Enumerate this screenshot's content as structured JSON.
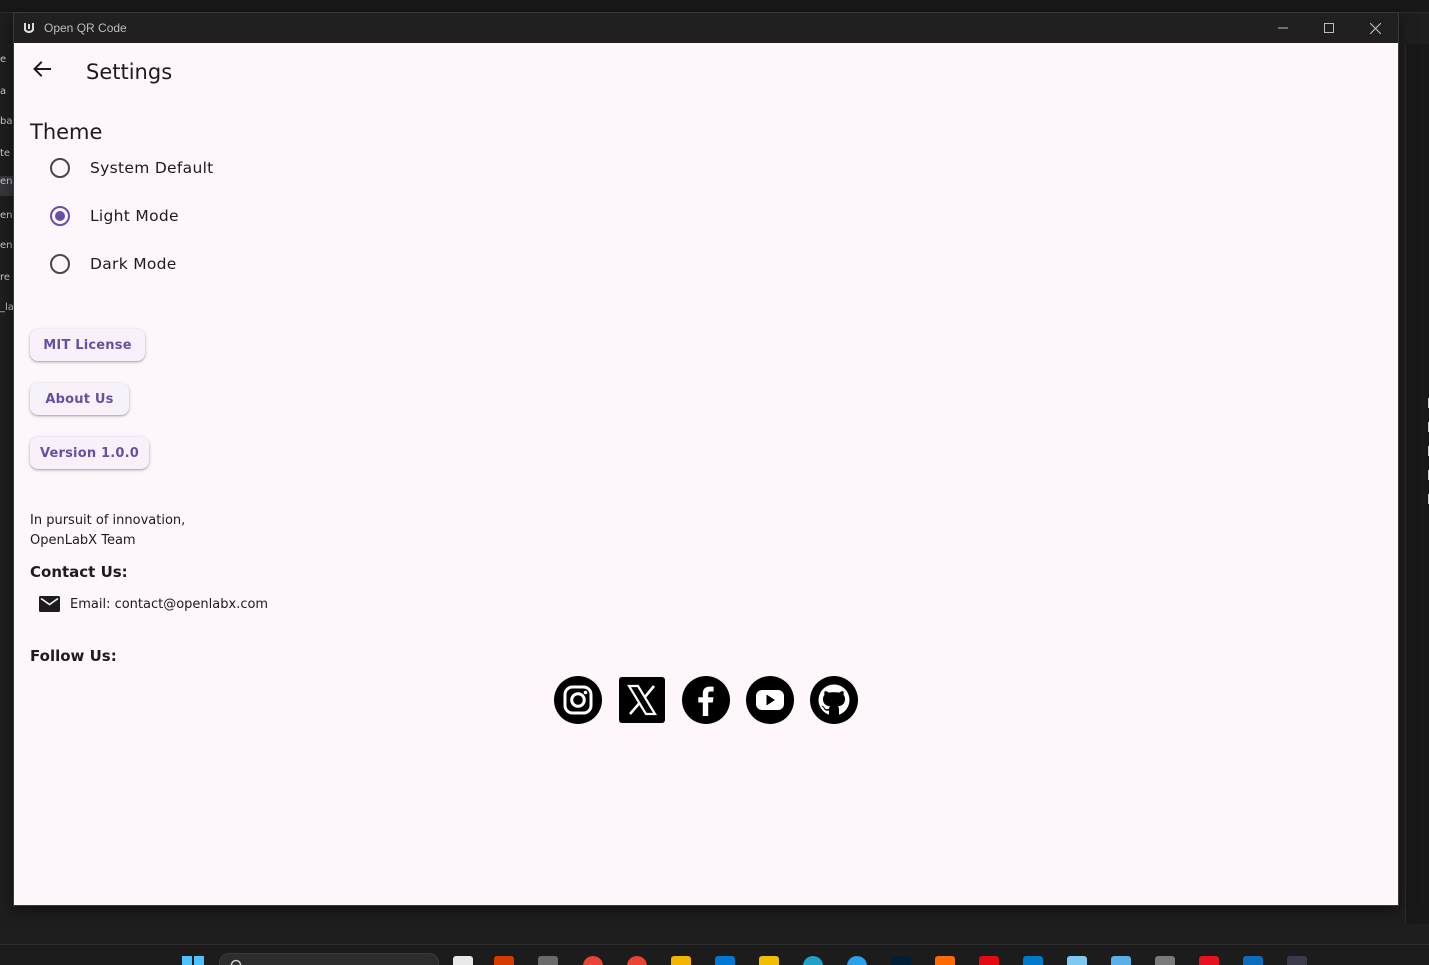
{
  "window": {
    "title": "Open QR Code"
  },
  "appbar": {
    "title": "Settings"
  },
  "theme": {
    "heading": "Theme",
    "options": [
      {
        "label": "System Default",
        "selected": false
      },
      {
        "label": "Light Mode",
        "selected": true
      },
      {
        "label": "Dark Mode",
        "selected": false
      }
    ]
  },
  "buttons": {
    "license": "MIT License",
    "about": "About Us",
    "version": "Version 1.0.0"
  },
  "footer": {
    "tagline_line1": "In pursuit of innovation,",
    "tagline_line2": "OpenLabX Team",
    "contact_heading": "Contact Us:",
    "email": "Email: contact@openlabx.com",
    "follow_heading": "Follow Us:",
    "social_icons": [
      "instagram-icon",
      "x-icon",
      "facebook-icon",
      "youtube-icon",
      "github-icon"
    ]
  },
  "colors": {
    "background": "#fdf7fc",
    "accent": "#6750a4",
    "text": "#1d1b20",
    "titlebar": "#202020"
  }
}
